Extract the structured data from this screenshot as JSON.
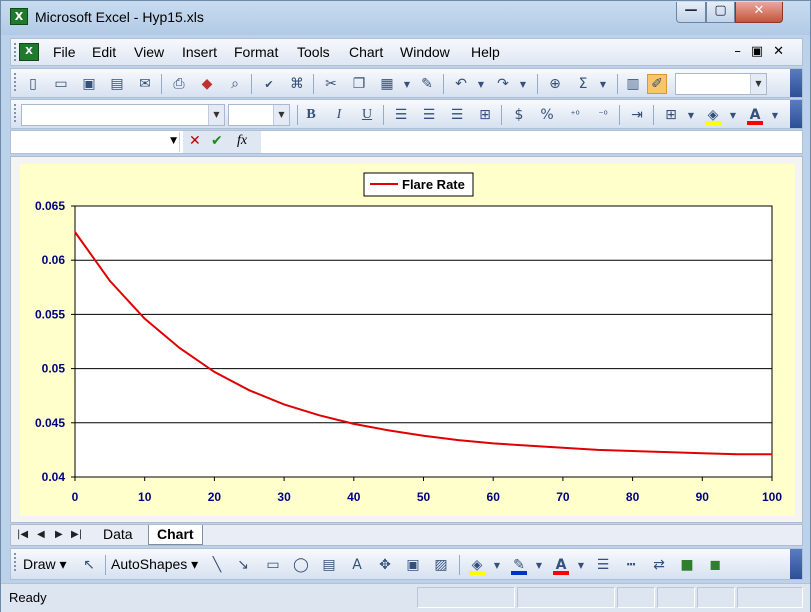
{
  "window": {
    "title": "Microsoft Excel - Hyp15.xls",
    "min": "—",
    "max": "▢",
    "close": "✕"
  },
  "menu": {
    "items": [
      "File",
      "Edit",
      "View",
      "Insert",
      "Format",
      "Tools",
      "Chart",
      "Window",
      "Help"
    ]
  },
  "sheet_tabs": {
    "tabs": [
      "Data",
      "Chart"
    ],
    "active": "Chart"
  },
  "drawing": {
    "draw_label": "Draw",
    "autoshapes_label": "AutoShapes"
  },
  "status": {
    "text": "Ready"
  },
  "colors": {
    "series": "#e00000",
    "chart_bg": "#ffffcc",
    "axis_label": "#000080"
  },
  "chart_data": {
    "type": "line",
    "title": "",
    "xlabel": "",
    "ylabel": "",
    "legend": "top-center",
    "grid": true,
    "xlim": [
      0,
      100
    ],
    "ylim": [
      0.04,
      0.065
    ],
    "x_ticks": [
      "0",
      "10",
      "20",
      "30",
      "40",
      "50",
      "60",
      "70",
      "80",
      "90",
      "100"
    ],
    "y_ticks": [
      "0.065",
      "0.06",
      "0.055",
      "0.05",
      "0.045",
      "0.04"
    ],
    "series": [
      {
        "name": "Flare Rate",
        "x": [
          0,
          5,
          10,
          15,
          20,
          25,
          30,
          35,
          40,
          45,
          50,
          55,
          60,
          65,
          70,
          75,
          80,
          85,
          90,
          95,
          100
        ],
        "y": [
          0.0626,
          0.0581,
          0.0546,
          0.0519,
          0.0497,
          0.048,
          0.0467,
          0.0457,
          0.0449,
          0.0443,
          0.0438,
          0.0434,
          0.0431,
          0.0429,
          0.0427,
          0.0425,
          0.0424,
          0.0423,
          0.0422,
          0.0421,
          0.0421
        ]
      }
    ]
  }
}
